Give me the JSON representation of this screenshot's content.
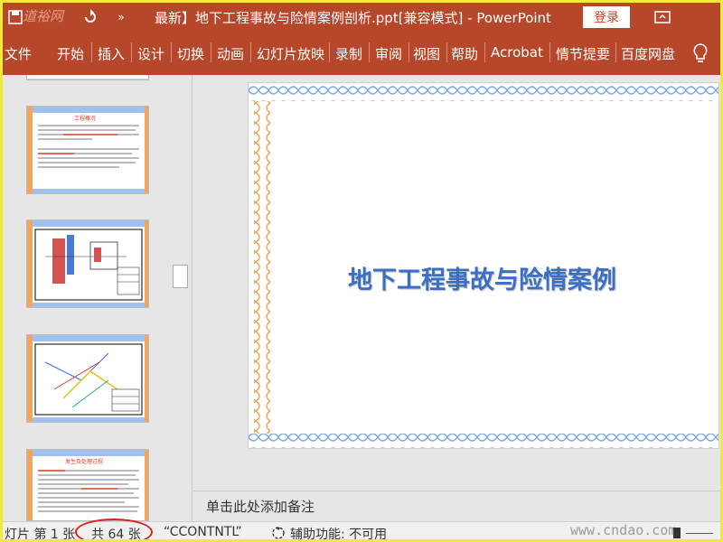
{
  "window": {
    "title": "最新】地下工程事故与险情案例剖析.ppt[兼容模式]  -  PowerPoint",
    "login_label": "登录",
    "watermark": "道裕网"
  },
  "ribbon": {
    "tabs": [
      "文件",
      "开始",
      "插入",
      "设计",
      "切换",
      "动画",
      "幻灯片放映",
      "录制",
      "审阅",
      "视图",
      "帮助",
      "Acrobat",
      "情节提要",
      "百度网盘"
    ]
  },
  "slide": {
    "title": "地下工程事故与险情案例"
  },
  "thumbnails": {
    "slide_a_heading": "工程概况",
    "slide_d_heading": "发生及处理过程"
  },
  "notes": {
    "placeholder": "单击此处添加备注"
  },
  "status": {
    "slide_info": "灯片 第 1 张",
    "total": "共 64 张",
    "template": "“CCONTNTL”",
    "accessibility": "辅助功能: 不可用",
    "watermark": "www.cndao.com"
  },
  "colors": {
    "accent": "#b7472a",
    "highlight_border": "#f0ea3a",
    "slide_title": "#3a6fc4",
    "circle_annotation": "#e0201a"
  }
}
